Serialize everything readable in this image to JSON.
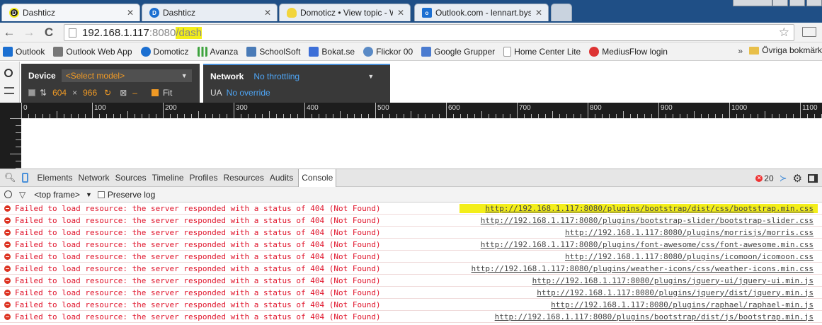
{
  "tabs": [
    {
      "title": "Dashticz",
      "favicon_color": "#f0c020",
      "highlight": true
    },
    {
      "title": "Dashticz",
      "favicon_color": "#1b6fd1",
      "highlight": false
    },
    {
      "title": "Domoticz • View topic - W",
      "favicon_color": "#f2d53c",
      "highlight": false
    },
    {
      "title": "Outlook.com - lennart.bys",
      "favicon_color": "#1b6fd1",
      "highlight": false
    }
  ],
  "address": {
    "host": "192.168.1.117",
    "port": ":8080",
    "path": "/dash"
  },
  "bookmarks": [
    {
      "label": "Outlook",
      "icon": "outlook-icon",
      "color": "#1b6fd1"
    },
    {
      "label": "Outlook Web App",
      "icon": "outlook-web-app-icon",
      "color": "#666"
    },
    {
      "label": "Domoticz",
      "icon": "domoticz-icon",
      "color": "#1b6fd1"
    },
    {
      "label": "Avanza",
      "icon": "avanza-icon",
      "color": "#3ea33e"
    },
    {
      "label": "SchoolSoft",
      "icon": "schoolsoft-icon",
      "color": "#4a7bb7"
    },
    {
      "label": "Bokat.se",
      "icon": "bokat-icon",
      "color": "#3d6fd8"
    },
    {
      "label": "Flickor 00",
      "icon": "flickor-icon",
      "color": "#5a8ac6"
    },
    {
      "label": "Google Grupper",
      "icon": "google-groups-icon",
      "color": "#4a7bd0"
    },
    {
      "label": "Home Center Lite",
      "icon": "document-icon",
      "color": "#ddd"
    },
    {
      "label": "MediusFlow login",
      "icon": "mediusflow-icon",
      "color": "#d33"
    }
  ],
  "bookmarks_more": "»",
  "bookmarks_folder": "Övriga bokmärk",
  "emulation": {
    "device_label": "Device",
    "device_value": "<Select model>",
    "width": "604",
    "times": "×",
    "height": "966",
    "dash": "–",
    "fit_label": "Fit",
    "network_label": "Network",
    "network_value": "No throttling",
    "ua_label": "UA",
    "ua_value": "No override"
  },
  "ruler_ticks": [
    "0",
    "100",
    "200",
    "300",
    "400",
    "500",
    "600",
    "700",
    "800",
    "900",
    "1000",
    "1100"
  ],
  "devtools": {
    "tabs": [
      "Elements",
      "Network",
      "Sources",
      "Timeline",
      "Profiles",
      "Resources",
      "Audits",
      "Console"
    ],
    "active_tab": "Console",
    "error_count": "20",
    "frame_selector": "<top frame>",
    "preserve_log": "Preserve log"
  },
  "console_rows": [
    {
      "message": "Failed to load resource: the server responded with a status of 404 (Not Found)",
      "source": "http://192.168.1.117:8080/plugins/bootstrap/dist/css/bootstrap.min.css",
      "highlight": true
    },
    {
      "message": "Failed to load resource: the server responded with a status of 404 (Not Found)",
      "source": "http://192.168.1.117:8080/plugins/bootstrap-slider/bootstrap-slider.css",
      "highlight": false
    },
    {
      "message": "Failed to load resource: the server responded with a status of 404 (Not Found)",
      "source": "http://192.168.1.117:8080/plugins/morrisjs/morris.css",
      "highlight": false
    },
    {
      "message": "Failed to load resource: the server responded with a status of 404 (Not Found)",
      "source": "http://192.168.1.117:8080/plugins/font-awesome/css/font-awesome.min.css",
      "highlight": false
    },
    {
      "message": "Failed to load resource: the server responded with a status of 404 (Not Found)",
      "source": "http://192.168.1.117:8080/plugins/icomoon/icomoon.css",
      "highlight": false
    },
    {
      "message": "Failed to load resource: the server responded with a status of 404 (Not Found)",
      "source": "http://192.168.1.117:8080/plugins/weather-icons/css/weather-icons.min.css",
      "highlight": false
    },
    {
      "message": "Failed to load resource: the server responded with a status of 404 (Not Found)",
      "source": "http://192.168.1.117:8080/plugins/jquery-ui/jquery-ui.min.js",
      "highlight": false
    },
    {
      "message": "Failed to load resource: the server responded with a status of 404 (Not Found)",
      "source": "http://192.168.1.117:8080/plugins/jquery/dist/jquery.min.js",
      "highlight": false
    },
    {
      "message": "Failed to load resource: the server responded with a status of 404 (Not Found)",
      "source": "http://192.168.1.117:8080/plugins/raphael/raphael-min.js",
      "highlight": false
    },
    {
      "message": "Failed to load resource: the server responded with a status of 404 (Not Found)",
      "source": "http://192.168.1.117:8080/plugins/bootstrap/dist/js/bootstrap.min.js",
      "highlight": false
    }
  ]
}
